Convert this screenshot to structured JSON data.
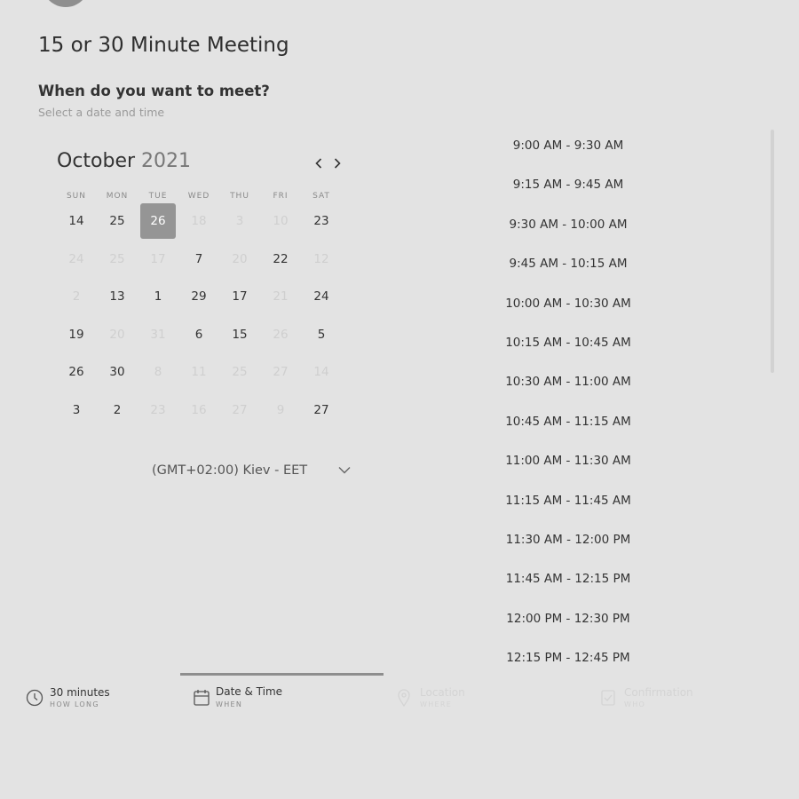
{
  "header": {
    "meeting_title": "15 or 30 Minute Meeting",
    "question": "When do you want to meet?",
    "subtitle": "Select a date and time"
  },
  "calendar": {
    "month": "October",
    "year": "2021",
    "weekdays": [
      "SUN",
      "MON",
      "TUE",
      "WED",
      "THU",
      "FRI",
      "SAT"
    ],
    "weeks": [
      [
        {
          "d": "14",
          "off": false
        },
        {
          "d": "25",
          "off": false
        },
        {
          "d": "26",
          "off": false,
          "sel": true
        },
        {
          "d": "18",
          "off": true
        },
        {
          "d": "3",
          "off": true
        },
        {
          "d": "10",
          "off": true
        },
        {
          "d": "23",
          "off": false
        }
      ],
      [
        {
          "d": "24",
          "off": true
        },
        {
          "d": "25",
          "off": true
        },
        {
          "d": "17",
          "off": true
        },
        {
          "d": "7",
          "off": false
        },
        {
          "d": "20",
          "off": true
        },
        {
          "d": "22",
          "off": false
        },
        {
          "d": "12",
          "off": true
        }
      ],
      [
        {
          "d": "2",
          "off": true
        },
        {
          "d": "13",
          "off": false
        },
        {
          "d": "1",
          "off": false
        },
        {
          "d": "29",
          "off": false
        },
        {
          "d": "17",
          "off": false
        },
        {
          "d": "21",
          "off": true
        },
        {
          "d": "24",
          "off": false
        }
      ],
      [
        {
          "d": "19",
          "off": false
        },
        {
          "d": "20",
          "off": true
        },
        {
          "d": "31",
          "off": true
        },
        {
          "d": "6",
          "off": false
        },
        {
          "d": "15",
          "off": false
        },
        {
          "d": "26",
          "off": true
        },
        {
          "d": "5",
          "off": false
        }
      ],
      [
        {
          "d": "26",
          "off": false
        },
        {
          "d": "30",
          "off": false
        },
        {
          "d": "8",
          "off": true
        },
        {
          "d": "11",
          "off": true
        },
        {
          "d": "25",
          "off": true
        },
        {
          "d": "27",
          "off": true
        },
        {
          "d": "14",
          "off": true
        }
      ],
      [
        {
          "d": "3",
          "off": false
        },
        {
          "d": "2",
          "off": false
        },
        {
          "d": "23",
          "off": true
        },
        {
          "d": "16",
          "off": true
        },
        {
          "d": "27",
          "off": true
        },
        {
          "d": "9",
          "off": true
        },
        {
          "d": "27",
          "off": false
        }
      ]
    ]
  },
  "timezone": {
    "label": "(GMT+02:00) Kiev - EET"
  },
  "time_slots": [
    "9:00 AM - 9:30 AM",
    "9:15 AM - 9:45 AM",
    "9:30 AM - 10:00 AM",
    "9:45 AM - 10:15 AM",
    "10:00 AM - 10:30 AM",
    "10:15 AM - 10:45 AM",
    "10:30 AM - 11:00 AM",
    "10:45 AM - 11:15 AM",
    "11:00 AM - 11:30 AM",
    "11:15 AM - 11:45 AM",
    "11:30 AM - 12:00 PM",
    "11:45 AM - 12:15 PM",
    "12:00 PM - 12:30 PM",
    "12:15 PM - 12:45 PM"
  ],
  "steps": [
    {
      "title": "30 minutes",
      "sub": "HOW LONG",
      "icon": "clock-icon"
    },
    {
      "title": "Date & Time",
      "sub": "WHEN",
      "icon": "calendar-icon"
    },
    {
      "title": "Location",
      "sub": "WHERE",
      "icon": "location-pin-icon"
    },
    {
      "title": "Confirmation",
      "sub": "WHO",
      "icon": "confirmation-icon"
    }
  ],
  "colors": {
    "background": "#e3e3e3",
    "selected_day": "#959595",
    "disabled_text": "#cfcfcf",
    "active_step_bar": "#8e8e8e"
  }
}
